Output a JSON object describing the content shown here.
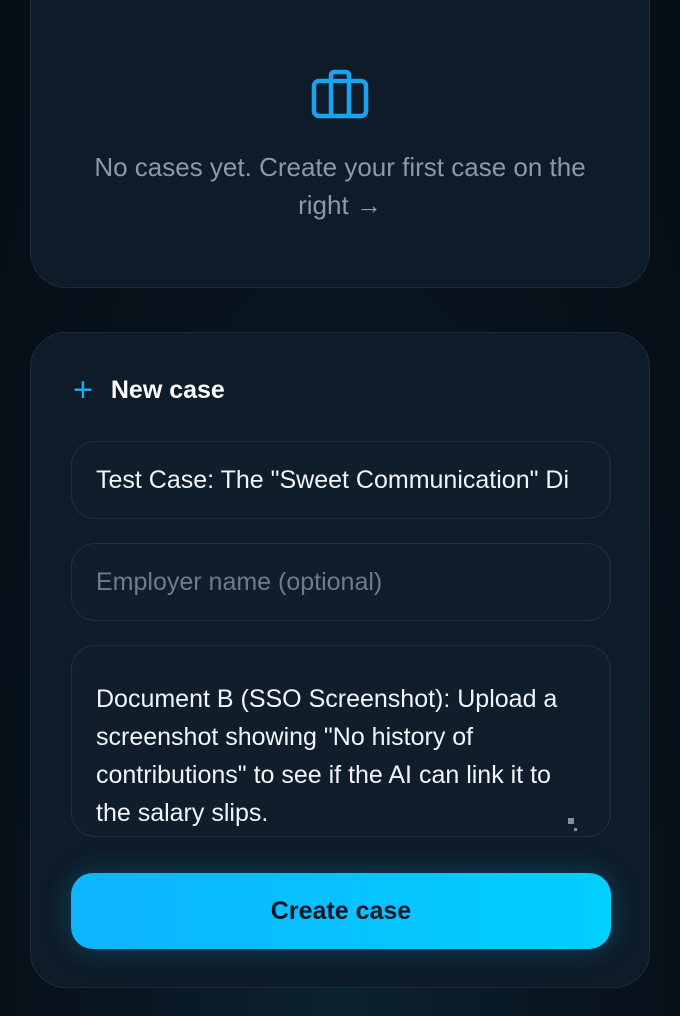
{
  "empty_state": {
    "icon": "briefcase-icon",
    "message": "No cases yet. Create your first case on the right →"
  },
  "new_case": {
    "icon": "plus-icon",
    "title": "New case",
    "case_title_value": "Test Case: The \"Sweet Communication\" Di",
    "employer_placeholder": "Employer name (optional)",
    "employer_value": "",
    "description_value": "Document B (SSO Screenshot): Upload a screenshot showing \"No history of contributions\" to see if the AI can link it to the salary slips.",
    "create_button_label": "Create case"
  },
  "colors": {
    "accent": "#22a8f0",
    "button": "#00c8ff",
    "background": "#08131d",
    "alert": "#3a0a0e"
  }
}
